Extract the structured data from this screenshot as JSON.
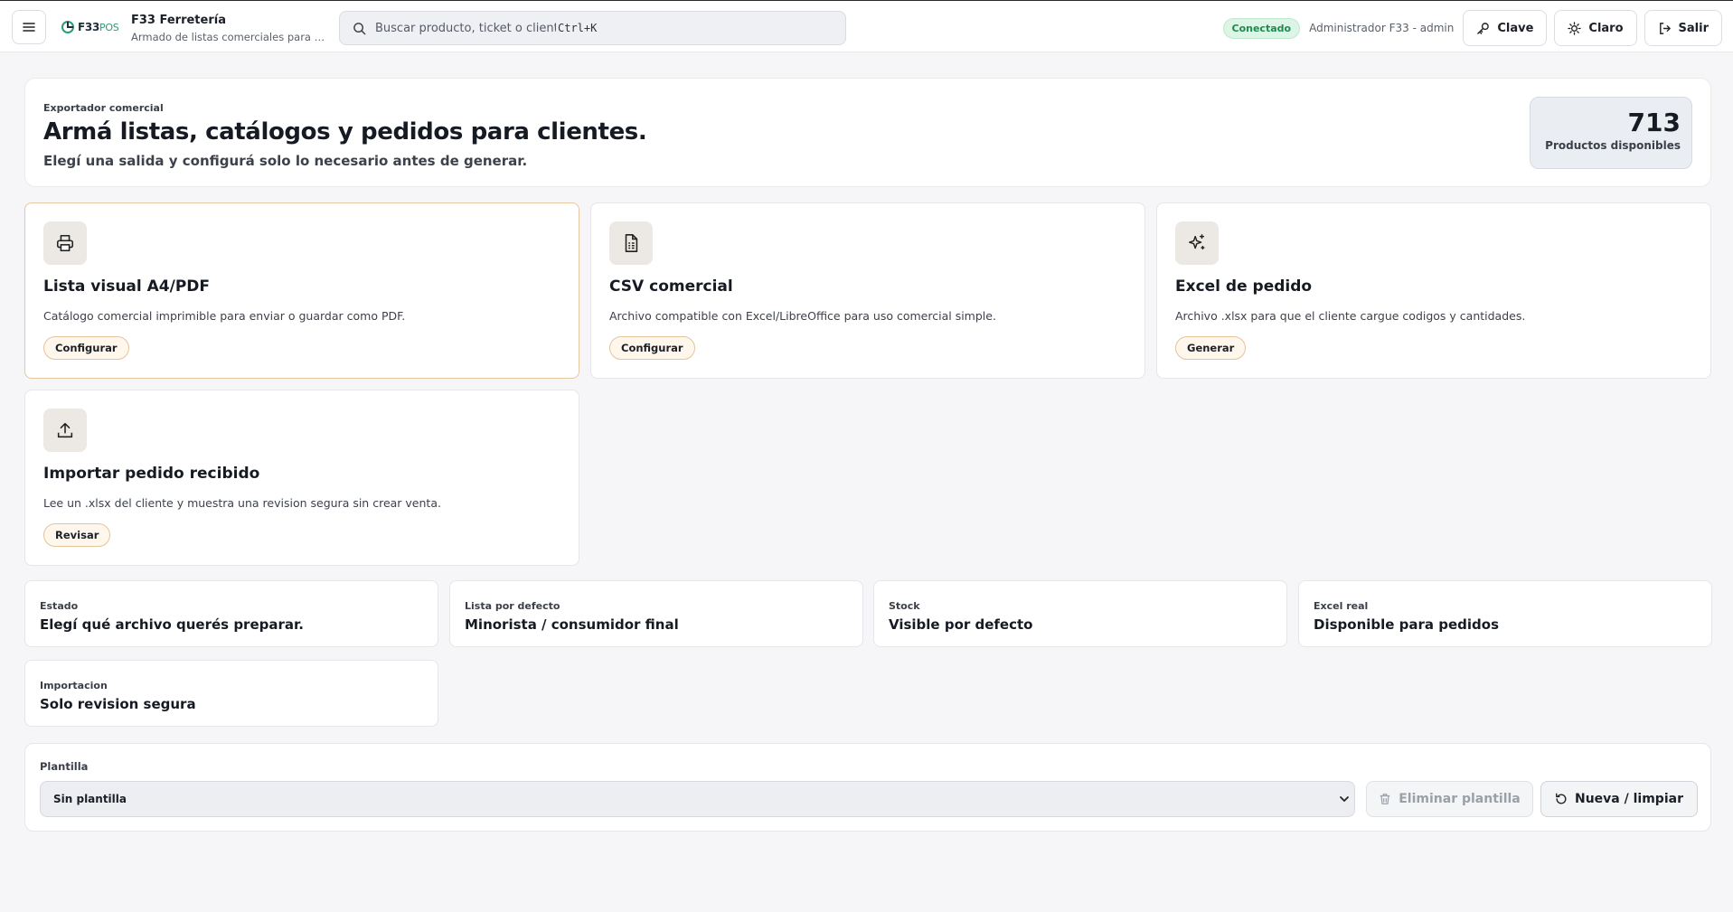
{
  "topbar": {
    "menu_icon": "menu-icon",
    "logo_text": "F33",
    "logo_suffix": "POS",
    "title": "F33 Ferretería",
    "subtitle": "Armado de listas comerciales para cli...",
    "search_placeholder": "Buscar producto, ticket o cliente",
    "search_shortcut": "Ctrl+K",
    "status": "Conectado",
    "status_color": "#1f8a4f",
    "user": "Administrador F33 - admin",
    "buttons": {
      "key": "Clave",
      "theme": "Claro",
      "logout": "Salir"
    }
  },
  "hero": {
    "kicker": "Exportador comercial",
    "title": "Armá listas, catálogos y pedidos para clientes.",
    "subtitle": "Elegí una salida y configurá solo lo necesario antes de generar.",
    "stat_value": "713",
    "stat_label": "Productos disponibles"
  },
  "cards": [
    {
      "icon": "printer-icon",
      "title": "Lista visual A4/PDF",
      "description": "Catálogo comercial imprimible para enviar o guardar como PDF.",
      "action": "Configurar"
    },
    {
      "icon": "file-spreadsheet-icon",
      "title": "CSV comercial",
      "description": "Archivo compatible con Excel/LibreOffice para uso comercial simple.",
      "action": "Configurar"
    },
    {
      "icon": "sparkles-icon",
      "title": "Excel de pedido",
      "description": "Archivo .xlsx para que el cliente cargue codigos y cantidades.",
      "action": "Generar"
    },
    {
      "icon": "upload-icon",
      "title": "Importar pedido recibido",
      "description": "Lee un .xlsx del cliente y muestra una revision segura sin crear venta.",
      "action": "Revisar"
    }
  ],
  "tiles": [
    {
      "label": "Estado",
      "value": "Elegí qué archivo querés preparar."
    },
    {
      "label": "Lista por defecto",
      "value": "Minorista / consumidor final"
    },
    {
      "label": "Stock",
      "value": "Visible por defecto"
    },
    {
      "label": "Excel real",
      "value": "Disponible para pedidos"
    },
    {
      "label": "Importacion",
      "value": "Solo revision segura"
    }
  ],
  "template": {
    "label": "Plantilla",
    "selected": "Sin plantilla",
    "delete_label": "Eliminar plantilla",
    "reset_label": "Nueva / limpiar"
  }
}
